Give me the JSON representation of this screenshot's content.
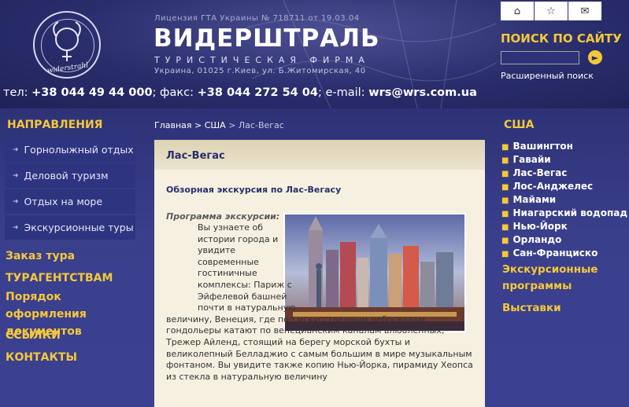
{
  "header": {
    "license": "Лицензия ГТА Украины № 718711 от 19.03.04",
    "brand": "ВИДЕРШТРАЛЬ",
    "brand_sub": "ТУРИСТИЧЕСКАЯ ФИРМА",
    "address": "Украина, 01025 г.Киев, ул. Б.Житомирская, 40",
    "logo_signature": "widerstrahl",
    "phone_label": "тел:",
    "phone": "+38 044 49 44 000",
    "fax_label": "; факс:",
    "fax": "+38 044 272 54 04",
    "email_label": "; e-mail:",
    "email": "wrs@wrs.com.ua"
  },
  "top_icons": [
    "home-icon",
    "star-icon",
    "mail-icon"
  ],
  "search": {
    "title": "ПОИСК ПО САЙТУ",
    "value": "",
    "advanced": "Расширенный поиск"
  },
  "left": {
    "section_title": "НАПРАВЛЕНИЯ",
    "directions": [
      {
        "label": "Горнолыжный отдых"
      },
      {
        "label": "Деловой туризм"
      },
      {
        "label": "Отдых на море"
      },
      {
        "label": "Экскурсионные туры"
      }
    ],
    "links": {
      "order": "Заказ тура",
      "agencies": "ТУРАГЕНТСТВАМ",
      "docs": "Порядок оформления документов",
      "links": "ССЫЛКИ",
      "contacts": "КОНТАКТЫ"
    }
  },
  "breadcrumb": {
    "home": "Главная",
    "sep": " > ",
    "usa": "США",
    "current": "Лас-Вегас"
  },
  "content": {
    "title": "Лас-Вегас",
    "excursion": "Обзорная экскурсия по Лас-Вегасу",
    "program_label": "Программа экскурсии:",
    "text_narrow": "Вы узнаете об истории города и увидите современные гостиничные комплексы: Париж с Эйфелевой башней почти в натуральную",
    "text_wide": "величину, Венеция, где под искусственным небосводом гондольеры катают по венецианским каналам влюбленных, Трежер Айленд, стоящий на берегу морской бухты и великолепный Белладжио с самым большим в мире музыкальным фонтаном. Вы увидите также копию Нью-Йорка, пирамиду Хеопса из стекла в натуральную величину"
  },
  "right": {
    "title": "США",
    "cities": [
      "Вашингтон",
      "Гавайи",
      "Лас-Вегас",
      "Лос-Анджелес",
      "Майами",
      "Ниагарский водопад",
      "Нью-Йорк",
      "Орландо",
      "Сан-Франциско"
    ],
    "excursion_programs": "Экскурсионные программы",
    "exhibitions": "Выставки"
  },
  "colors": {
    "accent": "#f4c83a",
    "background": "#3a3f8c",
    "content_bg": "#f5f0e0"
  }
}
